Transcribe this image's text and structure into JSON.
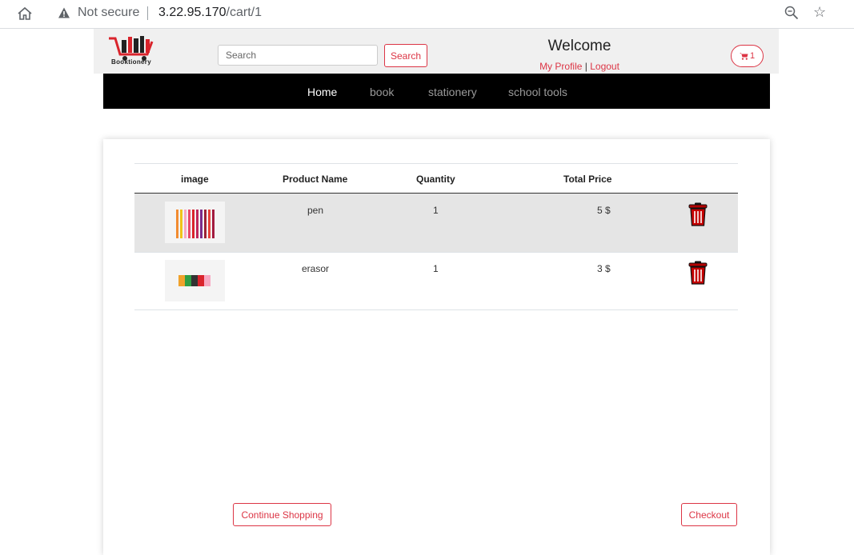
{
  "browser": {
    "security_label": "Not secure",
    "url_host": "3.22.95.170",
    "url_path": "/cart/1"
  },
  "header": {
    "logo_text": "Booktionery",
    "search_placeholder": "Search",
    "search_button": "Search",
    "welcome": "Welcome",
    "my_profile": "My Profile",
    "separator": "|",
    "logout": "Logout",
    "cart_count": "1"
  },
  "nav": {
    "items": [
      "Home",
      "book",
      "stationery",
      "school tools"
    ]
  },
  "cart": {
    "columns": [
      "image",
      "Product Name",
      "Quantity",
      "Total Price"
    ],
    "rows": [
      {
        "name": "pen",
        "quantity": "1",
        "total": "5 $"
      },
      {
        "name": "erasor",
        "quantity": "1",
        "total": "3 $"
      }
    ],
    "continue_button": "Continue Shopping",
    "checkout_button": "Checkout"
  },
  "colors": {
    "accent": "#dc3545",
    "nav_bg": "#000000",
    "header_bg": "#f0f0f0",
    "row_highlight": "#e5e5e5"
  },
  "icons": [
    "home-icon",
    "warning-icon",
    "zoom-icon",
    "star-icon",
    "cart-icon",
    "trash-icon"
  ]
}
